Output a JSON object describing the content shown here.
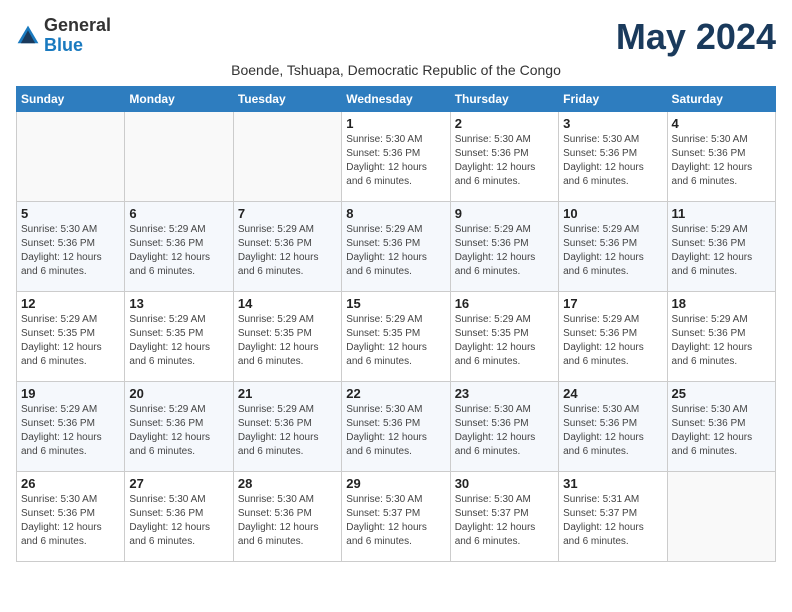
{
  "logo": {
    "general": "General",
    "blue": "Blue"
  },
  "title": "May 2024",
  "subtitle": "Boende, Tshuapa, Democratic Republic of the Congo",
  "days_of_week": [
    "Sunday",
    "Monday",
    "Tuesday",
    "Wednesday",
    "Thursday",
    "Friday",
    "Saturday"
  ],
  "weeks": [
    [
      {
        "day": "",
        "info": ""
      },
      {
        "day": "",
        "info": ""
      },
      {
        "day": "",
        "info": ""
      },
      {
        "day": "1",
        "info": "Sunrise: 5:30 AM\nSunset: 5:36 PM\nDaylight: 12 hours\nand 6 minutes."
      },
      {
        "day": "2",
        "info": "Sunrise: 5:30 AM\nSunset: 5:36 PM\nDaylight: 12 hours\nand 6 minutes."
      },
      {
        "day": "3",
        "info": "Sunrise: 5:30 AM\nSunset: 5:36 PM\nDaylight: 12 hours\nand 6 minutes."
      },
      {
        "day": "4",
        "info": "Sunrise: 5:30 AM\nSunset: 5:36 PM\nDaylight: 12 hours\nand 6 minutes."
      }
    ],
    [
      {
        "day": "5",
        "info": "Sunrise: 5:30 AM\nSunset: 5:36 PM\nDaylight: 12 hours\nand 6 minutes."
      },
      {
        "day": "6",
        "info": "Sunrise: 5:29 AM\nSunset: 5:36 PM\nDaylight: 12 hours\nand 6 minutes."
      },
      {
        "day": "7",
        "info": "Sunrise: 5:29 AM\nSunset: 5:36 PM\nDaylight: 12 hours\nand 6 minutes."
      },
      {
        "day": "8",
        "info": "Sunrise: 5:29 AM\nSunset: 5:36 PM\nDaylight: 12 hours\nand 6 minutes."
      },
      {
        "day": "9",
        "info": "Sunrise: 5:29 AM\nSunset: 5:36 PM\nDaylight: 12 hours\nand 6 minutes."
      },
      {
        "day": "10",
        "info": "Sunrise: 5:29 AM\nSunset: 5:36 PM\nDaylight: 12 hours\nand 6 minutes."
      },
      {
        "day": "11",
        "info": "Sunrise: 5:29 AM\nSunset: 5:36 PM\nDaylight: 12 hours\nand 6 minutes."
      }
    ],
    [
      {
        "day": "12",
        "info": "Sunrise: 5:29 AM\nSunset: 5:35 PM\nDaylight: 12 hours\nand 6 minutes."
      },
      {
        "day": "13",
        "info": "Sunrise: 5:29 AM\nSunset: 5:35 PM\nDaylight: 12 hours\nand 6 minutes."
      },
      {
        "day": "14",
        "info": "Sunrise: 5:29 AM\nSunset: 5:35 PM\nDaylight: 12 hours\nand 6 minutes."
      },
      {
        "day": "15",
        "info": "Sunrise: 5:29 AM\nSunset: 5:35 PM\nDaylight: 12 hours\nand 6 minutes."
      },
      {
        "day": "16",
        "info": "Sunrise: 5:29 AM\nSunset: 5:35 PM\nDaylight: 12 hours\nand 6 minutes."
      },
      {
        "day": "17",
        "info": "Sunrise: 5:29 AM\nSunset: 5:36 PM\nDaylight: 12 hours\nand 6 minutes."
      },
      {
        "day": "18",
        "info": "Sunrise: 5:29 AM\nSunset: 5:36 PM\nDaylight: 12 hours\nand 6 minutes."
      }
    ],
    [
      {
        "day": "19",
        "info": "Sunrise: 5:29 AM\nSunset: 5:36 PM\nDaylight: 12 hours\nand 6 minutes."
      },
      {
        "day": "20",
        "info": "Sunrise: 5:29 AM\nSunset: 5:36 PM\nDaylight: 12 hours\nand 6 minutes."
      },
      {
        "day": "21",
        "info": "Sunrise: 5:29 AM\nSunset: 5:36 PM\nDaylight: 12 hours\nand 6 minutes."
      },
      {
        "day": "22",
        "info": "Sunrise: 5:30 AM\nSunset: 5:36 PM\nDaylight: 12 hours\nand 6 minutes."
      },
      {
        "day": "23",
        "info": "Sunrise: 5:30 AM\nSunset: 5:36 PM\nDaylight: 12 hours\nand 6 minutes."
      },
      {
        "day": "24",
        "info": "Sunrise: 5:30 AM\nSunset: 5:36 PM\nDaylight: 12 hours\nand 6 minutes."
      },
      {
        "day": "25",
        "info": "Sunrise: 5:30 AM\nSunset: 5:36 PM\nDaylight: 12 hours\nand 6 minutes."
      }
    ],
    [
      {
        "day": "26",
        "info": "Sunrise: 5:30 AM\nSunset: 5:36 PM\nDaylight: 12 hours\nand 6 minutes."
      },
      {
        "day": "27",
        "info": "Sunrise: 5:30 AM\nSunset: 5:36 PM\nDaylight: 12 hours\nand 6 minutes."
      },
      {
        "day": "28",
        "info": "Sunrise: 5:30 AM\nSunset: 5:36 PM\nDaylight: 12 hours\nand 6 minutes."
      },
      {
        "day": "29",
        "info": "Sunrise: 5:30 AM\nSunset: 5:37 PM\nDaylight: 12 hours\nand 6 minutes."
      },
      {
        "day": "30",
        "info": "Sunrise: 5:30 AM\nSunset: 5:37 PM\nDaylight: 12 hours\nand 6 minutes."
      },
      {
        "day": "31",
        "info": "Sunrise: 5:31 AM\nSunset: 5:37 PM\nDaylight: 12 hours\nand 6 minutes."
      },
      {
        "day": "",
        "info": ""
      }
    ]
  ]
}
